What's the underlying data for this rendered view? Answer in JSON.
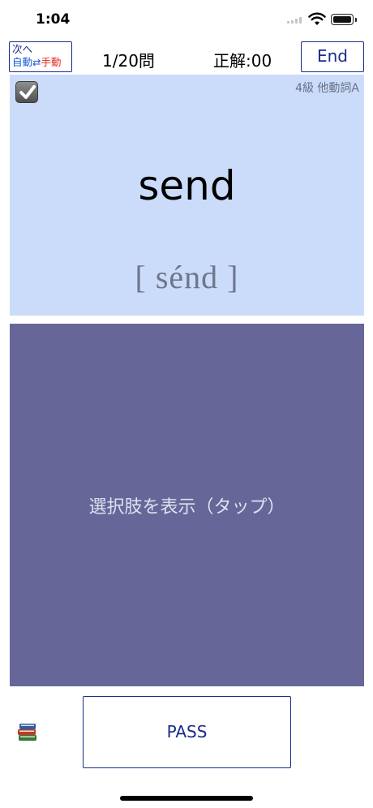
{
  "status_bar": {
    "time": "1:04"
  },
  "header": {
    "next_label": "次へ",
    "auto_label": "自動",
    "toggle_arrow": "⇄",
    "manual_label": "手動",
    "progress": "1/20問",
    "score": "正解:00",
    "end_label": "End"
  },
  "card": {
    "tag": "4級  他動詞A",
    "word": "send",
    "pronunciation": "[ sénd ]",
    "checked": true
  },
  "choices": {
    "label": "選択肢を表示（タップ）"
  },
  "footer": {
    "pass_label": "PASS"
  },
  "icons": {
    "status": [
      "signal-icon",
      "wifi-icon",
      "battery-icon"
    ],
    "card": "checkbox-icon",
    "footer": "books-icon"
  },
  "colors": {
    "accent": "#1a2b8c",
    "auto": "#1a5bd8",
    "manual": "#e4281f",
    "card_bg": "#cadcfa",
    "choice_bg": "#666698"
  }
}
